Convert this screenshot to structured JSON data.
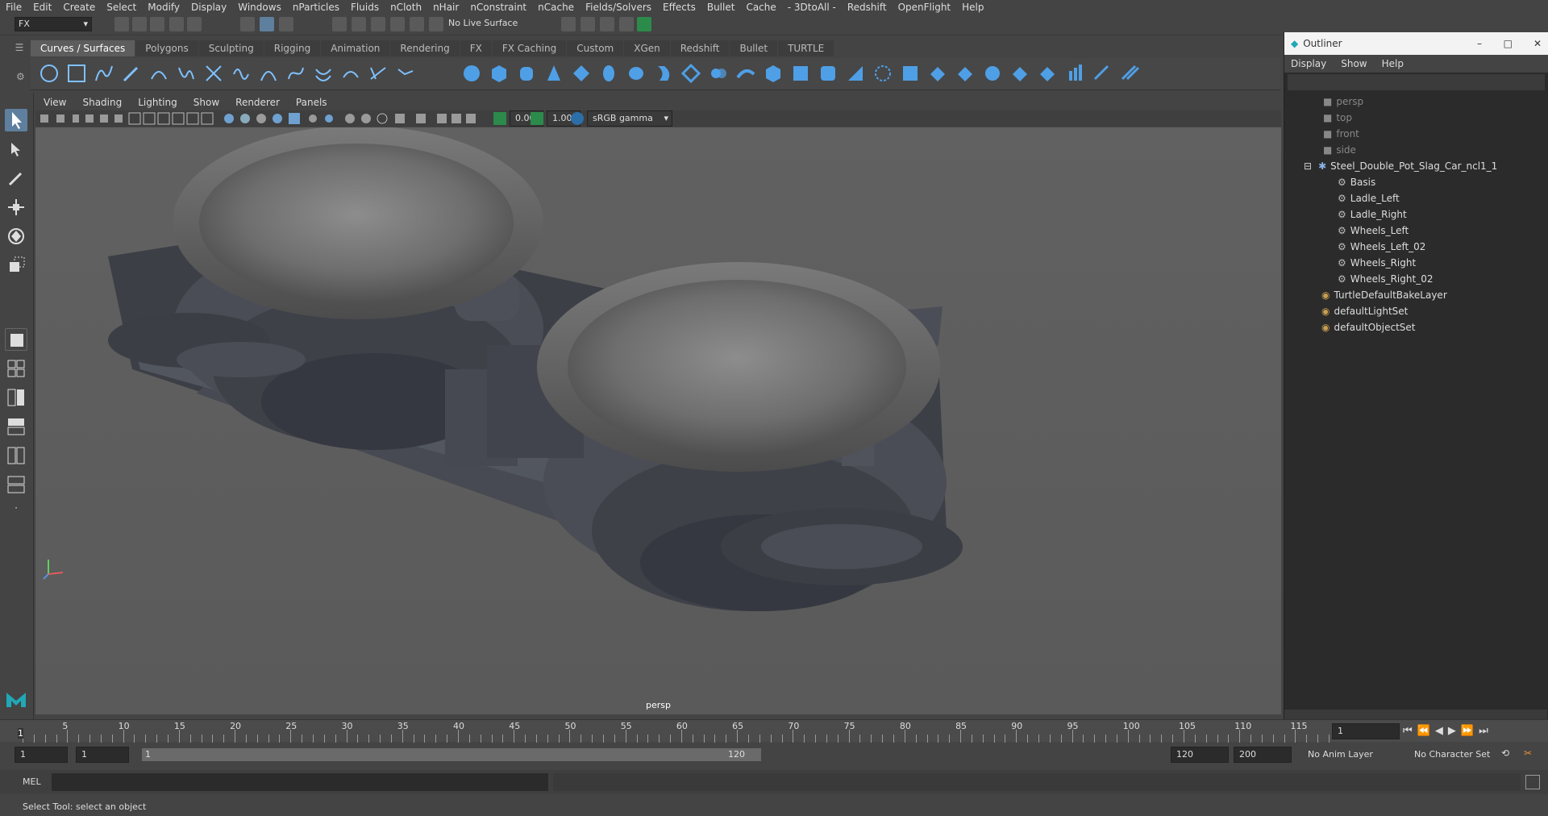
{
  "menubar": [
    "File",
    "Edit",
    "Create",
    "Select",
    "Modify",
    "Display",
    "Windows",
    "nParticles",
    "Fluids",
    "nCloth",
    "nHair",
    "nConstraint",
    "nCache",
    "Fields/Solvers",
    "Effects",
    "Bullet",
    "Cache",
    "- 3DtoAll -",
    "Redshift",
    "OpenFlight",
    "Help"
  ],
  "statusline": {
    "mode": "FX",
    "live_surface": "No Live Surface"
  },
  "shelf_tabs": [
    "Curves / Surfaces",
    "Polygons",
    "Sculpting",
    "Rigging",
    "Animation",
    "Rendering",
    "FX",
    "FX Caching",
    "Custom",
    "XGen",
    "Redshift",
    "Bullet",
    "TURTLE"
  ],
  "active_shelf": "Curves / Surfaces",
  "viewport": {
    "menu": [
      "View",
      "Shading",
      "Lighting",
      "Show",
      "Renderer",
      "Panels"
    ],
    "exposure": "0.00",
    "gamma": "1.00",
    "color_space": "sRGB gamma",
    "camera_label": "persp"
  },
  "outliner": {
    "title": "Outliner",
    "menu": [
      "Display",
      "Show",
      "Help"
    ],
    "cameras": [
      "persp",
      "top",
      "front",
      "side"
    ],
    "group": "Steel_Double_Pot_Slag_Car_ncl1_1",
    "children": [
      "Basis",
      "Ladle_Left",
      "Ladle_Right",
      "Wheels_Left",
      "Wheels_Left_02",
      "Wheels_Right",
      "Wheels_Right_02"
    ],
    "sets": [
      "TurtleDefaultBakeLayer",
      "defaultLightSet",
      "defaultObjectSet"
    ]
  },
  "timeline": {
    "ticks": [
      "5",
      "10",
      "15",
      "20",
      "25",
      "30",
      "35",
      "40",
      "45",
      "50",
      "55",
      "60",
      "65",
      "70",
      "75",
      "80",
      "85",
      "90",
      "95",
      "100",
      "105",
      "110",
      "115"
    ],
    "start_marker": "1",
    "current_frame": "1"
  },
  "range": {
    "start": "1",
    "playback_start": "1",
    "slider_start": "1",
    "slider_end": "120",
    "playback_end": "120",
    "end": "200",
    "anim_layer": "No Anim Layer",
    "character_set": "No Character Set"
  },
  "cmdline": {
    "label": "MEL"
  },
  "helpline": "Select Tool: select an object"
}
